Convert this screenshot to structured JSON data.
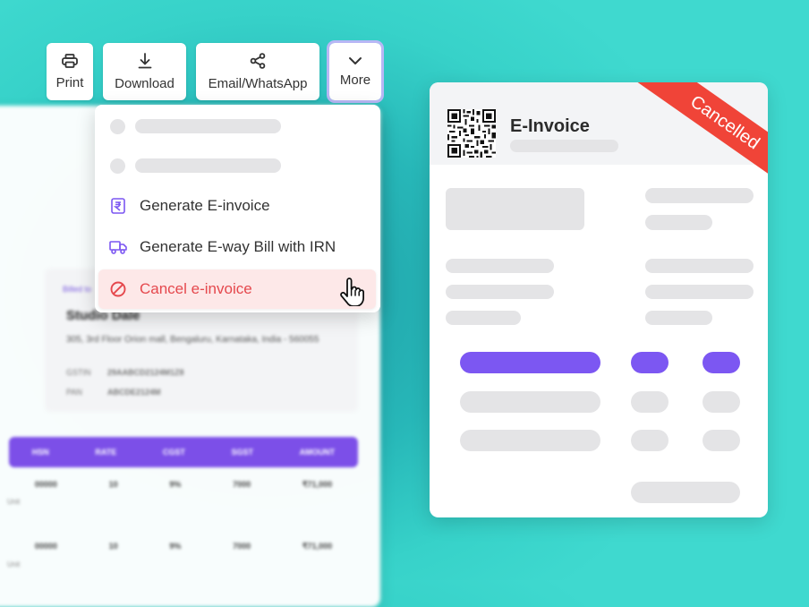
{
  "toolbar": {
    "print_label": "Print",
    "download_label": "Download",
    "share_label": "Email/WhatsApp",
    "more_label": "More"
  },
  "menu": {
    "items": [
      {
        "label": "Generate E-invoice",
        "icon": "rupee-doc-icon"
      },
      {
        "label": "Generate E-way Bill with IRN",
        "icon": "truck-icon"
      },
      {
        "label": "Cancel e-invoice",
        "icon": "ban-icon"
      }
    ]
  },
  "card": {
    "title": "E-Invoice",
    "status": "Cancelled"
  },
  "background_invoice": {
    "tag": "Billed to",
    "company": "Studio Dale",
    "address": "305, 3rd Floor Orion mall, Bengaluru, Karnataka, India - 560055",
    "fields": [
      {
        "label": "GSTIN",
        "value": "29AABCD2124M1Z8"
      },
      {
        "label": "PAN",
        "value": "ABCDE2124M"
      }
    ],
    "columns": [
      "HSN",
      "RATE",
      "CGST",
      "SGST",
      "AMOUNT"
    ],
    "rows": [
      [
        "00000",
        "10",
        "9%",
        "7000",
        "₹71,000"
      ],
      [
        "00000",
        "10",
        "9%",
        "7000",
        "₹71,000"
      ]
    ],
    "row_sub": "Unit"
  },
  "colors": {
    "accent": "#7c57f2",
    "danger": "#f04438",
    "teal": "#27b7b8"
  }
}
